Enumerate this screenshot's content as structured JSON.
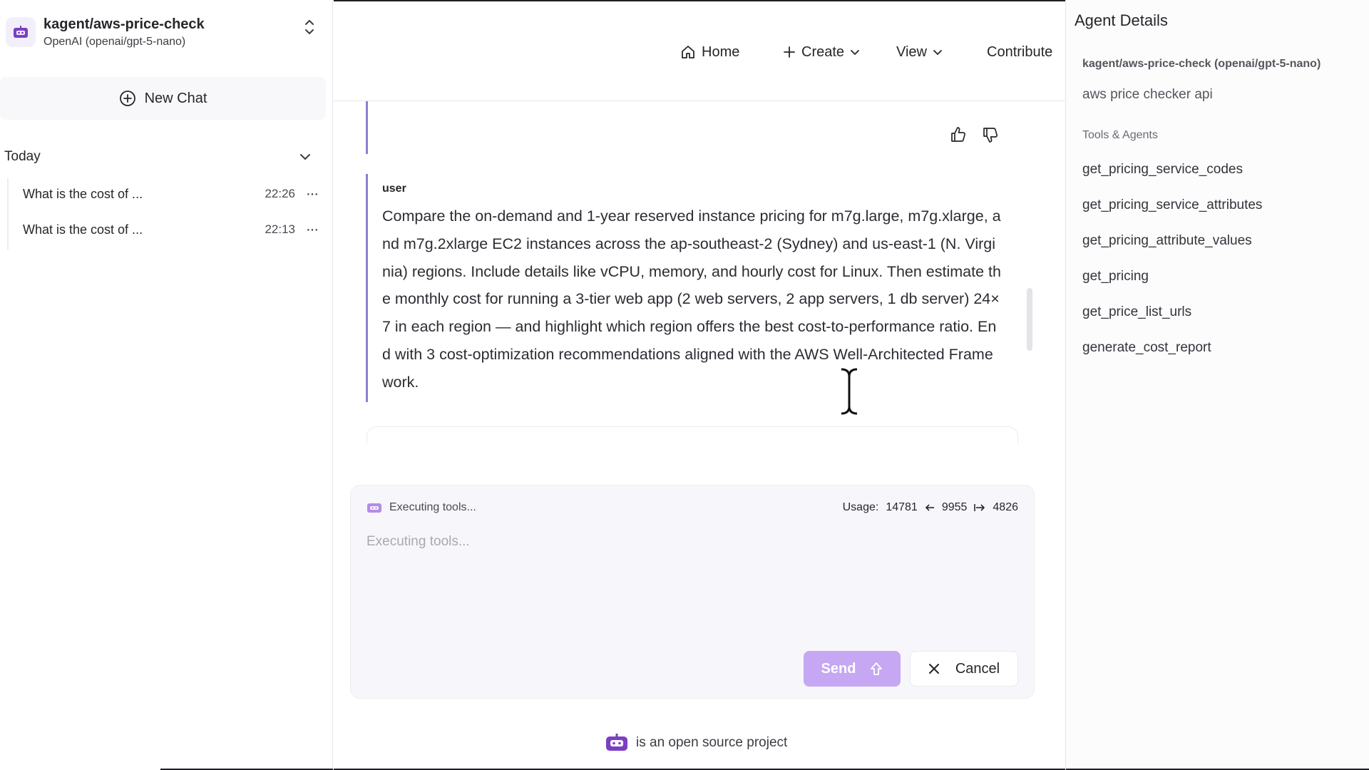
{
  "sidebar": {
    "agent_name": "kagent/aws-price-check",
    "agent_model": "OpenAI (openai/gpt-5-nano)",
    "new_chat_label": "New Chat",
    "group_label": "Today",
    "history": [
      {
        "title": "What is the cost of ...",
        "time": "22:26",
        "menu": "···"
      },
      {
        "title": "What is the cost of ...",
        "time": "22:13",
        "menu": "···"
      }
    ]
  },
  "nav": {
    "home": "Home",
    "create": "Create",
    "view": "View",
    "contribute": "Contribute"
  },
  "chat": {
    "user_label": "user",
    "user_message": "Compare the on-demand and 1-year reserved instance pricing for m7g.large, m7g.xlarge, and m7g.2xlarge EC2 instances across the ap-southeast-2 (Sydney) and us-east-1 (N. Virginia) regions. Include details like vCPU, memory, and hourly cost for Linux. Then estimate the monthly cost for running a 3-tier web app (2 web servers, 2 app servers, 1 db server) 24×7 in each region — and highlight which region offers the best cost-to-performance ratio. End with 3 cost-optimization recommendations aligned with the AWS Well-Architected Framework."
  },
  "composer": {
    "status": "Executing tools...",
    "usage_label": "Usage:",
    "usage_total": "14781",
    "usage_in": "9955",
    "usage_out": "4826",
    "placeholder": "Executing tools...",
    "send_label": "Send",
    "cancel_label": "Cancel"
  },
  "footer": {
    "text": "is an open source project"
  },
  "details": {
    "title": "Agent Details",
    "agent": "kagent/aws-price-check (openai/gpt-5-nano)",
    "description": "aws price checker api",
    "tools_heading": "Tools & Agents",
    "tools": [
      "get_pricing_service_codes",
      "get_pricing_service_attributes",
      "get_pricing_attribute_values",
      "get_pricing",
      "get_price_list_urls",
      "generate_cost_report"
    ]
  },
  "colors": {
    "accent": "#8a7fd0",
    "send_button": "#c5a7f3",
    "logo": "#7b3fc4"
  },
  "icons": [
    "robot-logo-icon",
    "chevron-up-down-icon",
    "plus-circle-icon",
    "chevron-down-icon",
    "home-icon",
    "plus-icon",
    "thumbs-up-icon",
    "thumbs-down-icon",
    "arrow-up-icon",
    "close-icon",
    "text-cursor-icon"
  ]
}
